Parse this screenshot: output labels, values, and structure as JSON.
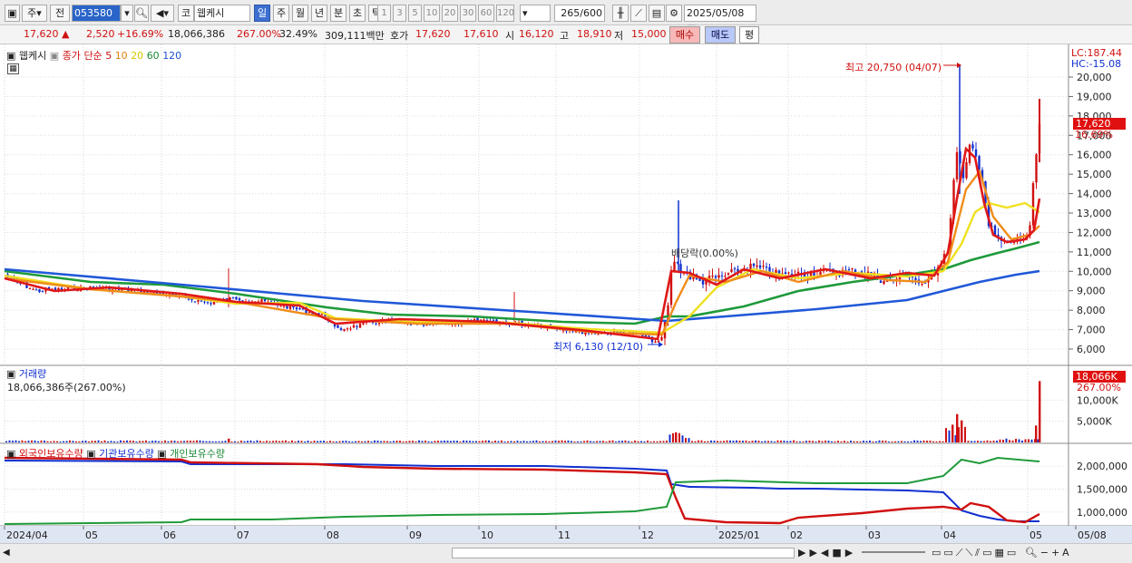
{
  "toolbar": {
    "code": "053580",
    "market": "코",
    "name": "웹케시",
    "btn_ju": "주",
    "btn_jeon": "전",
    "periods": [
      "일",
      "주",
      "월",
      "년",
      "분",
      "초",
      "틱"
    ],
    "selected_period": "일",
    "nums": [
      "1",
      "3",
      "5",
      "10",
      "20",
      "30",
      "60",
      "120"
    ],
    "count": "265",
    "count_total": "/600",
    "date": "2025/05/08"
  },
  "quote": {
    "price": "17,620",
    "change": "2,520",
    "change_pct": "+16.69%",
    "volume": "18,066,386",
    "vol_ratio": "267.00%",
    "turnover": "32.49%",
    "amount": "309,111백만",
    "ask_label": "호가",
    "ask": "17,620",
    "bid": "17,610",
    "open_label": "시",
    "open": "16,120",
    "high_label": "고",
    "high": "18,910",
    "low_label": "저",
    "low": "15,000",
    "buy": "매수",
    "sell": "매도",
    "eval": "평"
  },
  "legend": {
    "name": "웹케시",
    "close": "종가",
    "simple": "단순",
    "ma": [
      "5",
      "10",
      "20",
      "60",
      "120"
    ]
  },
  "price_annot": {
    "max": "최고 20,750 (04/07)",
    "min": "최저 6,130 (12/10)",
    "exdiv": "배당락(0.00%)",
    "lc": "LC:187.44",
    "hc": "HC:-15.08",
    "cur": "17,620",
    "cur_pct": "16.69%"
  },
  "volume_panel": {
    "title": "거래량",
    "value": "18,066,386주(267.00%)",
    "cur": "18,066K",
    "cur_pct": "267.00%",
    "ticks": [
      "10,000K",
      "5,000K"
    ]
  },
  "holding_panel": {
    "foreign": "외국인보유수량",
    "inst": "기관보유수량",
    "indiv": "개인보유수량",
    "ticks": [
      "2,000,000",
      "1,500,000",
      "1,000,000"
    ]
  },
  "colors": {
    "up": "#d01010",
    "down": "#1030d0",
    "ma5": "#e01818",
    "ma10": "#f08c1a",
    "ma20": "#f0e020",
    "ma60": "#1e9a3a",
    "ma120": "#2058d8"
  },
  "chart_data": {
    "type": "candlestick",
    "y_ticks": [
      20000,
      19000,
      18000,
      17000,
      16000,
      15000,
      14000,
      13000,
      12000,
      11000,
      10000,
      9000,
      8000,
      7000,
      6000
    ],
    "x_labels": [
      "2024/04",
      "05",
      "06",
      "07",
      "08",
      "09",
      "10",
      "11",
      "12",
      "2025/01",
      "02",
      "03",
      "04",
      "05",
      "05/08"
    ],
    "ohlc_approx": [
      {
        "date": "2024/04",
        "close": 9500
      },
      {
        "date": "2024/05",
        "close": 9100
      },
      {
        "date": "2024/06",
        "close": 8800
      },
      {
        "date": "2024/07",
        "close": 8300
      },
      {
        "date": "2024/08",
        "close": 7300
      },
      {
        "date": "2024/09",
        "close": 7100
      },
      {
        "date": "2024/10",
        "close": 7200
      },
      {
        "date": "2024/11",
        "close": 6900
      },
      {
        "date": "2024/12/10",
        "close": 6130
      },
      {
        "date": "2024/12",
        "close": 9600
      },
      {
        "date": "2025/01",
        "close": 9800
      },
      {
        "date": "2025/02",
        "close": 9500
      },
      {
        "date": "2025/03",
        "close": 9800
      },
      {
        "date": "2025/04/07",
        "close": 19000
      },
      {
        "date": "2025/04",
        "close": 11800
      },
      {
        "date": "2025/05/08",
        "close": 17620
      }
    ],
    "max": {
      "date": "04/07",
      "value": 20750
    },
    "min": {
      "date": "12/10",
      "value": 6130
    }
  }
}
